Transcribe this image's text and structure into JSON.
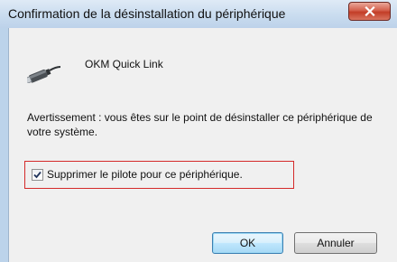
{
  "window": {
    "title": "Confirmation de la désinstallation du périphérique",
    "close_label": "X"
  },
  "device": {
    "icon": "usb-cable-icon",
    "name": "OKM Quick Link"
  },
  "warning": {
    "text": "Avertissement : vous êtes sur le point de désinstaller ce périphérique de votre système."
  },
  "driver_option": {
    "label": "Supprimer le pilote pour ce périphérique.",
    "checked": true
  },
  "buttons": {
    "ok_label": "OK",
    "cancel_label": "Annuler"
  },
  "colors": {
    "highlight_border": "#d42a2a",
    "title_bar": "#c9dcef",
    "close_button": "#c23d27"
  }
}
